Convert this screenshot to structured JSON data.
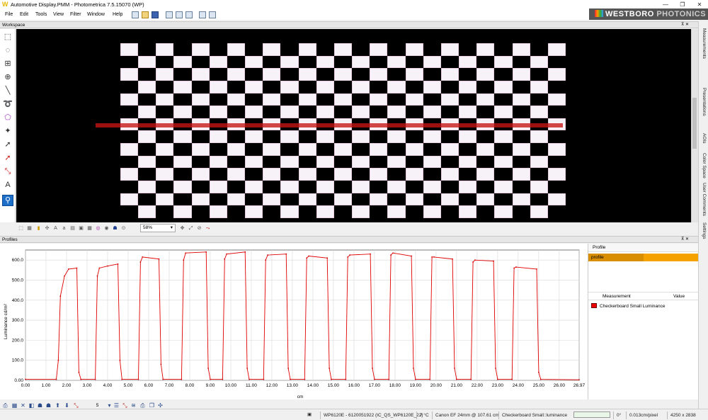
{
  "window": {
    "title": "Automotive Display.PMM - Photometrica 7.5.15070 (WP)",
    "minimize_glyph": "—",
    "restore_glyph": "❐",
    "close_glyph": "✕"
  },
  "menu": [
    "File",
    "Edit",
    "Tools",
    "View",
    "Filter",
    "Window",
    "Help"
  ],
  "brand": {
    "name_first": "WESTBORO",
    "name_second": "PHOTONICS"
  },
  "workspace": {
    "header": "Workspace",
    "zoom_value": "58%",
    "pin_glyph": "⊼ ✕"
  },
  "right_tabs": [
    "Measurements",
    "Presentations",
    "AOIs",
    "Color Space",
    "User Comments",
    "Settings"
  ],
  "profiles": {
    "header": "Profiles",
    "profile_col": "Profile",
    "profile_name": "profile",
    "measurement_col": "Measurement",
    "value_col": "Value",
    "measurement_name": "Checkerboard Small Luminance",
    "pin_glyph": "⊼ ✕",
    "bottom_count": "5"
  },
  "status": {
    "camera": "WP6120E - 6120051922 (IC_QS_WP6120E_22)",
    "temperature": "7 °C",
    "lens": "Canon EF 24mm @ 107.61 cm",
    "measurement": "Checkerboard Small::luminance",
    "progress_fraction": 0.0,
    "angle": "0°",
    "scale": "0.013cm/pixel",
    "resolution": "4250 x 2838"
  },
  "colors": {
    "accent": "#1e6fc8",
    "profile_highlight": "#f5a200",
    "trace": "#e00000",
    "profile_line": "#c81414"
  },
  "chart_data": {
    "type": "line",
    "title": "",
    "xlabel": "cm",
    "ylabel": "Luminance  cd/m²",
    "xlim": [
      0,
      26.97
    ],
    "ylim": [
      0,
      650
    ],
    "x_ticks": [
      "0.00",
      "1.00",
      "2.00",
      "3.00",
      "4.00",
      "5.00",
      "6.00",
      "7.00",
      "8.00",
      "9.00",
      "10.00",
      "11.00",
      "12.00",
      "13.00",
      "14.00",
      "15.00",
      "16.00",
      "17.00",
      "18.00",
      "19.00",
      "20.00",
      "21.00",
      "22.00",
      "23.00",
      "24.00",
      "25.00",
      "26.00",
      "26.97"
    ],
    "y_ticks": [
      "0.00",
      "100.0",
      "200.0",
      "300.0",
      "400.0",
      "500.0",
      "600.0"
    ],
    "grid": true,
    "series": [
      {
        "name": "Checkerboard Small Luminance",
        "x": [
          0,
          1.5,
          1.6,
          1.7,
          1.9,
          2.1,
          2.5,
          2.6,
          2.7,
          3.4,
          3.5,
          3.6,
          4.0,
          4.5,
          4.6,
          4.7,
          5.5,
          5.6,
          5.7,
          6.5,
          6.6,
          6.7,
          7.6,
          7.7,
          7.8,
          8.8,
          8.9,
          9.0,
          9.6,
          9.7,
          9.8,
          10.7,
          10.8,
          10.9,
          11.6,
          11.7,
          11.8,
          12.7,
          12.8,
          12.9,
          13.6,
          13.7,
          13.8,
          14.7,
          14.8,
          14.9,
          15.6,
          15.7,
          15.8,
          16.8,
          16.9,
          17.0,
          17.7,
          17.8,
          17.9,
          18.8,
          18.9,
          19.0,
          19.7,
          19.8,
          19.9,
          20.8,
          20.9,
          21.0,
          21.7,
          21.8,
          21.9,
          22.8,
          22.9,
          23.0,
          23.7,
          23.8,
          23.9,
          24.9,
          25.0,
          25.1,
          26.97
        ],
        "y": [
          5,
          5,
          100,
          420,
          520,
          555,
          560,
          40,
          5,
          5,
          520,
          560,
          570,
          580,
          100,
          5,
          5,
          590,
          615,
          605,
          80,
          5,
          5,
          600,
          635,
          640,
          60,
          5,
          5,
          605,
          630,
          640,
          60,
          5,
          5,
          600,
          625,
          630,
          60,
          5,
          5,
          610,
          620,
          610,
          60,
          5,
          5,
          615,
          625,
          630,
          60,
          5,
          5,
          625,
          635,
          620,
          60,
          5,
          5,
          615,
          615,
          605,
          60,
          5,
          5,
          590,
          600,
          595,
          60,
          5,
          5,
          560,
          565,
          555,
          40,
          5,
          3
        ]
      }
    ]
  }
}
